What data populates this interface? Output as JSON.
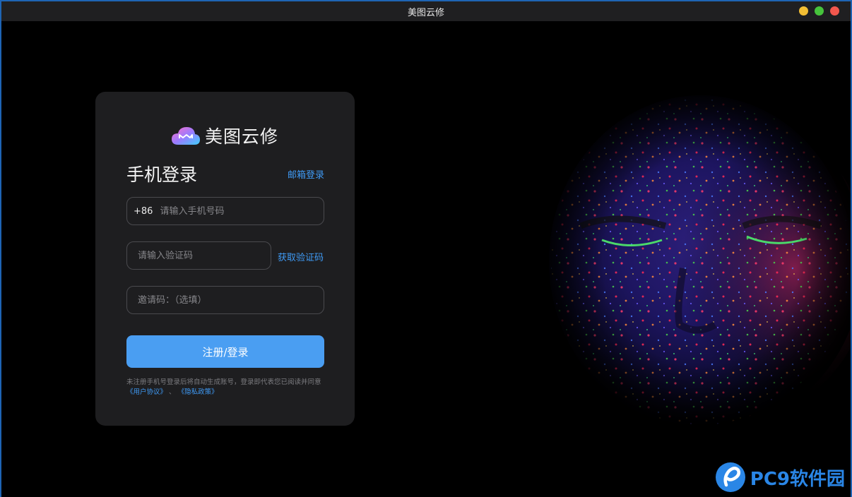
{
  "window": {
    "title": "美图云修"
  },
  "brand": {
    "name": "美图云修",
    "logo": "cloud-logo-icon"
  },
  "login": {
    "title": "手机登录",
    "alt_login_link": "邮箱登录",
    "phone": {
      "prefix": "+86",
      "placeholder": "请输入手机号码",
      "value": ""
    },
    "code": {
      "placeholder": "请输入验证码",
      "value": "",
      "get_code_label": "获取验证码"
    },
    "invite": {
      "placeholder": "邀请码：（选填）",
      "value": ""
    },
    "submit_label": "注册/登录",
    "agreement": {
      "text_prefix": "未注册手机号登录后将自动生成账号，登录即代表您已阅读并同意",
      "user_agreement": "《用户协议》",
      "separator": "、",
      "privacy_policy": "《隐私政策》"
    }
  },
  "watermark": {
    "text": "PC9软件园"
  },
  "colors": {
    "accent": "#4a9ef2",
    "link": "#3f9af5",
    "card_bg": "#1e1e20",
    "window_min": "#f2be34",
    "window_max": "#46c43c",
    "window_close": "#f2574d"
  }
}
